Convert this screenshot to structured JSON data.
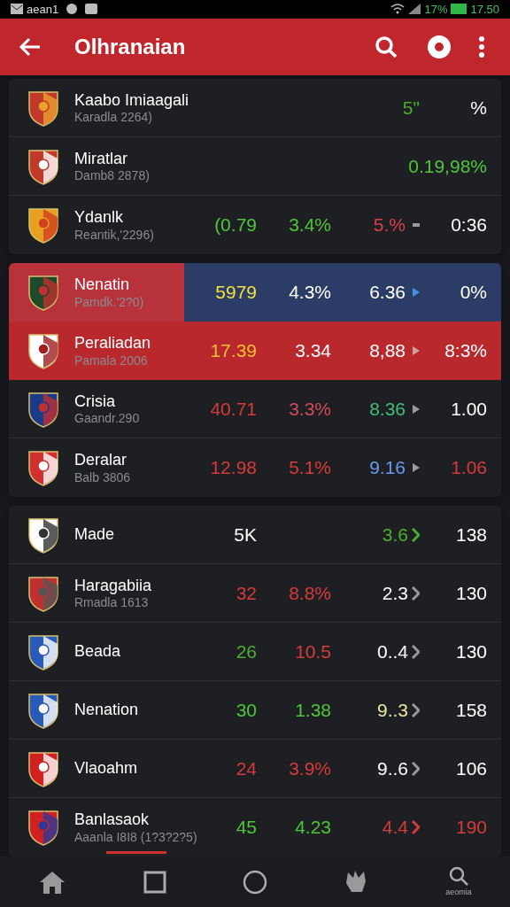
{
  "status_bar": {
    "carrier": "aean1",
    "battery": "17%",
    "time": "17.50"
  },
  "app_bar": {
    "title": "Olhranaian"
  },
  "cards": [
    {
      "rows": [
        {
          "name": "Kaabo Imiaagali",
          "subtitle": "Karadla 2264)",
          "selected": false,
          "kind": "plain",
          "column_3": {
            "text": "5\"",
            "color": "#4caf2e"
          },
          "column_4": {
            "text": "%",
            "color": "#ffffff"
          }
        },
        {
          "name": "Miratlar",
          "subtitle": "Damb8 2878)",
          "selected": false,
          "kind": "plain",
          "column_4": {
            "text": "0.19,98%",
            "color": "#4fc63a"
          }
        },
        {
          "name": "Ydanlk",
          "subtitle": "Reantik,'2296)",
          "selected": false,
          "kind": "plain",
          "column_1": {
            "text": "(0.79",
            "color": "#4fc63a"
          },
          "column_2": {
            "text": "3.4%",
            "color": "#4fc63a"
          },
          "column_3": {
            "text": "5.%",
            "color": "#d9404a"
          },
          "column_4": {
            "text": "0:36",
            "color": "#ffffff"
          },
          "arrow": {
            "kind": "dash",
            "color": "#9a9a9a"
          }
        }
      ]
    },
    {
      "rows": [
        {
          "name": "Nenatin",
          "subtitle": "Pamdk.'2?0)",
          "selected": true,
          "kind": "split",
          "color": "#b8323c",
          "column_1": {
            "text": "5979",
            "color": "#f0e040"
          },
          "column_2": {
            "text": "4.3%",
            "color": "#ffffff"
          },
          "column_3": {
            "text": "6.36",
            "color": "#ffffff"
          },
          "column_4": {
            "text": "0%",
            "color": "#ffffff"
          },
          "arrow": {
            "kind": "triangle",
            "color": "#4a90e2"
          }
        },
        {
          "name": "Peraliadan",
          "subtitle": "Pamala 2006",
          "selected": true,
          "kind": "plain",
          "color": "#b8282c",
          "column_1": {
            "text": "17.39",
            "color": "#f5c030"
          },
          "column_2": {
            "text": "3.34",
            "color": "#ffffff"
          },
          "column_3": {
            "text": "8,88",
            "color": "#ffffff"
          },
          "column_4": {
            "text": "8:3%",
            "color": "#ffffff"
          },
          "arrow": {
            "kind": "triangle",
            "color": "#d0a0a0"
          }
        },
        {
          "name": "Crisia",
          "subtitle": "Gaandr.290",
          "selected": false,
          "kind": "plain",
          "column_1": {
            "text": "40.71",
            "color": "#d83a3a"
          },
          "column_2": {
            "text": "3.3%",
            "color": "#d84a5a"
          },
          "column_3": {
            "text": "8.36",
            "color": "#3fbf7a"
          },
          "column_4": {
            "text": "1.00",
            "color": "#ffffff"
          },
          "arrow": {
            "kind": "triangle",
            "color": "#9a9a9a"
          }
        },
        {
          "name": "Deralar",
          "subtitle": "Balb 3806",
          "selected": false,
          "kind": "plain",
          "column_1": {
            "text": "12.98",
            "color": "#d83a3a"
          },
          "column_2": {
            "text": "5.1%",
            "color": "#d83a3a"
          },
          "column_3": {
            "text": "9.16",
            "color": "#6a9af0"
          },
          "column_4": {
            "text": "1.06",
            "color": "#d83a3a"
          },
          "arrow": {
            "kind": "triangle",
            "color": "#9a9a9a"
          }
        }
      ]
    },
    {
      "rows": [
        {
          "name": "Made",
          "selected": false,
          "kind": "plain",
          "column_1": {
            "text": "5K",
            "color": "#ffffff"
          },
          "column_3": {
            "text": "3.6",
            "color": "#4caf2e"
          },
          "column_4": {
            "text": "138",
            "color": "#ffffff"
          },
          "arrow": {
            "kind": "chevron",
            "color": "#4caf2e"
          }
        },
        {
          "name": "Haragabiia",
          "subtitle": "Rmadla 1613",
          "selected": false,
          "kind": "plain",
          "column_1": {
            "text": "32",
            "color": "#d83a3a"
          },
          "column_2": {
            "text": "8.8%",
            "color": "#d83a3a"
          },
          "column_3": {
            "text": "2.3",
            "color": "#ffffff"
          },
          "column_4": {
            "text": "130",
            "color": "#ffffff"
          },
          "arrow": {
            "kind": "chevron",
            "color": "#9a9a9a"
          }
        },
        {
          "name": "Beada",
          "selected": false,
          "kind": "plain",
          "column_1": {
            "text": "26",
            "color": "#4caf2e"
          },
          "column_2": {
            "text": "10.5",
            "color": "#d83a3a"
          },
          "column_3": {
            "text": "0..4",
            "color": "#ffffff"
          },
          "column_4": {
            "text": "130",
            "color": "#ffffff"
          },
          "arrow": {
            "kind": "chevron",
            "color": "#9a9a9a"
          }
        },
        {
          "name": "Nenation",
          "selected": false,
          "kind": "plain",
          "column_1": {
            "text": "30",
            "color": "#4fc63a"
          },
          "column_2": {
            "text": "1.38",
            "color": "#4fc63a"
          },
          "column_3": {
            "text": "9..3",
            "color": "#e8e8a0"
          },
          "column_4": {
            "text": "158",
            "color": "#ffffff"
          },
          "arrow": {
            "kind": "chevron",
            "color": "#9a9a9a"
          }
        },
        {
          "name": "Vlaoahm",
          "selected": false,
          "kind": "plain",
          "column_1": {
            "text": "24",
            "color": "#d83a3a"
          },
          "column_2": {
            "text": "3.9%",
            "color": "#d83a3a"
          },
          "column_3": {
            "text": "9..6",
            "color": "#ffffff"
          },
          "column_4": {
            "text": "106",
            "color": "#ffffff"
          },
          "arrow": {
            "kind": "chevron",
            "color": "#9a9a9a"
          }
        },
        {
          "name": "Banlasaok",
          "subtitle": "Aaanla I8I8 (1?3?2?5)",
          "selected": false,
          "kind": "plain",
          "column_1": {
            "text": "45",
            "color": "#4fc63a"
          },
          "column_2": {
            "text": "4.23",
            "color": "#4fc63a"
          },
          "column_3": {
            "text": "4.4",
            "color": "#d83a3a"
          },
          "column_4": {
            "text": "190",
            "color": "#d83a3a"
          },
          "arrow": {
            "kind": "chevron",
            "color": "#d83a3a"
          }
        }
      ]
    }
  ],
  "bottom_nav": {
    "search_label": "aeomia"
  }
}
